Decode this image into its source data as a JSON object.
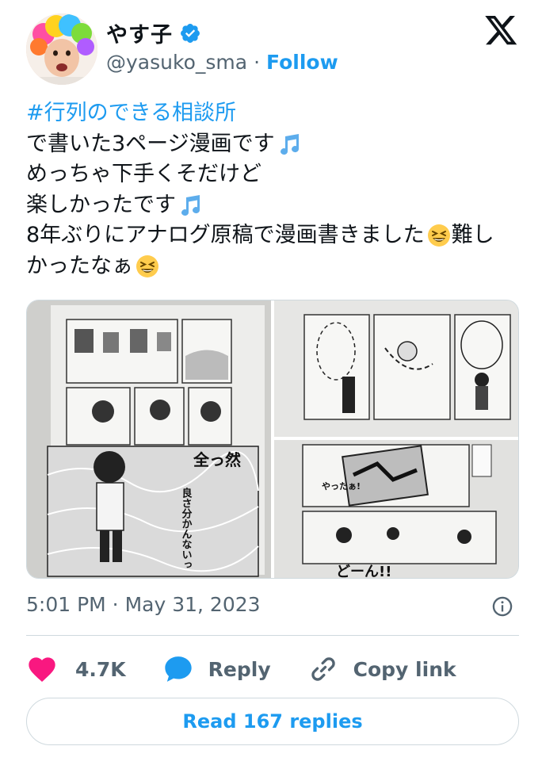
{
  "author": {
    "name": "やす子",
    "handle": "@yasuko_sma",
    "separator": "·",
    "follow_label": "Follow"
  },
  "tweet": {
    "hashtag": "#行列のできる相談所",
    "line1": "で書いた3ページ漫画です",
    "line2": "めっちゃ下手くそだけど",
    "line3": "楽しかったです",
    "line4": "8年ぶりにアナログ原稿で漫画書きました",
    "line4_end": "難し",
    "line5": "かったなぁ"
  },
  "media": {
    "images": [
      {
        "name": "manga-page-1",
        "caption_large": "全っ然",
        "caption_small": "良さ分かんないっ"
      },
      {
        "name": "manga-page-2"
      },
      {
        "name": "manga-page-3",
        "caption": "どーん!!",
        "caption2": "やったぁ!"
      }
    ]
  },
  "timestamp": "5:01 PM · May 31, 2023",
  "actions": {
    "like_count": "4.7K",
    "reply_label": "Reply",
    "copy_label": "Copy link"
  },
  "read_replies_label": "Read 167 replies",
  "colors": {
    "accent": "#1d9bf0",
    "like": "#f91880",
    "muted": "#536471",
    "border": "#cfd9de"
  },
  "icons": [
    "verified-badge-icon",
    "x-logo-icon",
    "music-note-icon",
    "laughing-emoji-icon",
    "info-icon",
    "heart-icon",
    "reply-bubble-icon",
    "link-icon"
  ]
}
